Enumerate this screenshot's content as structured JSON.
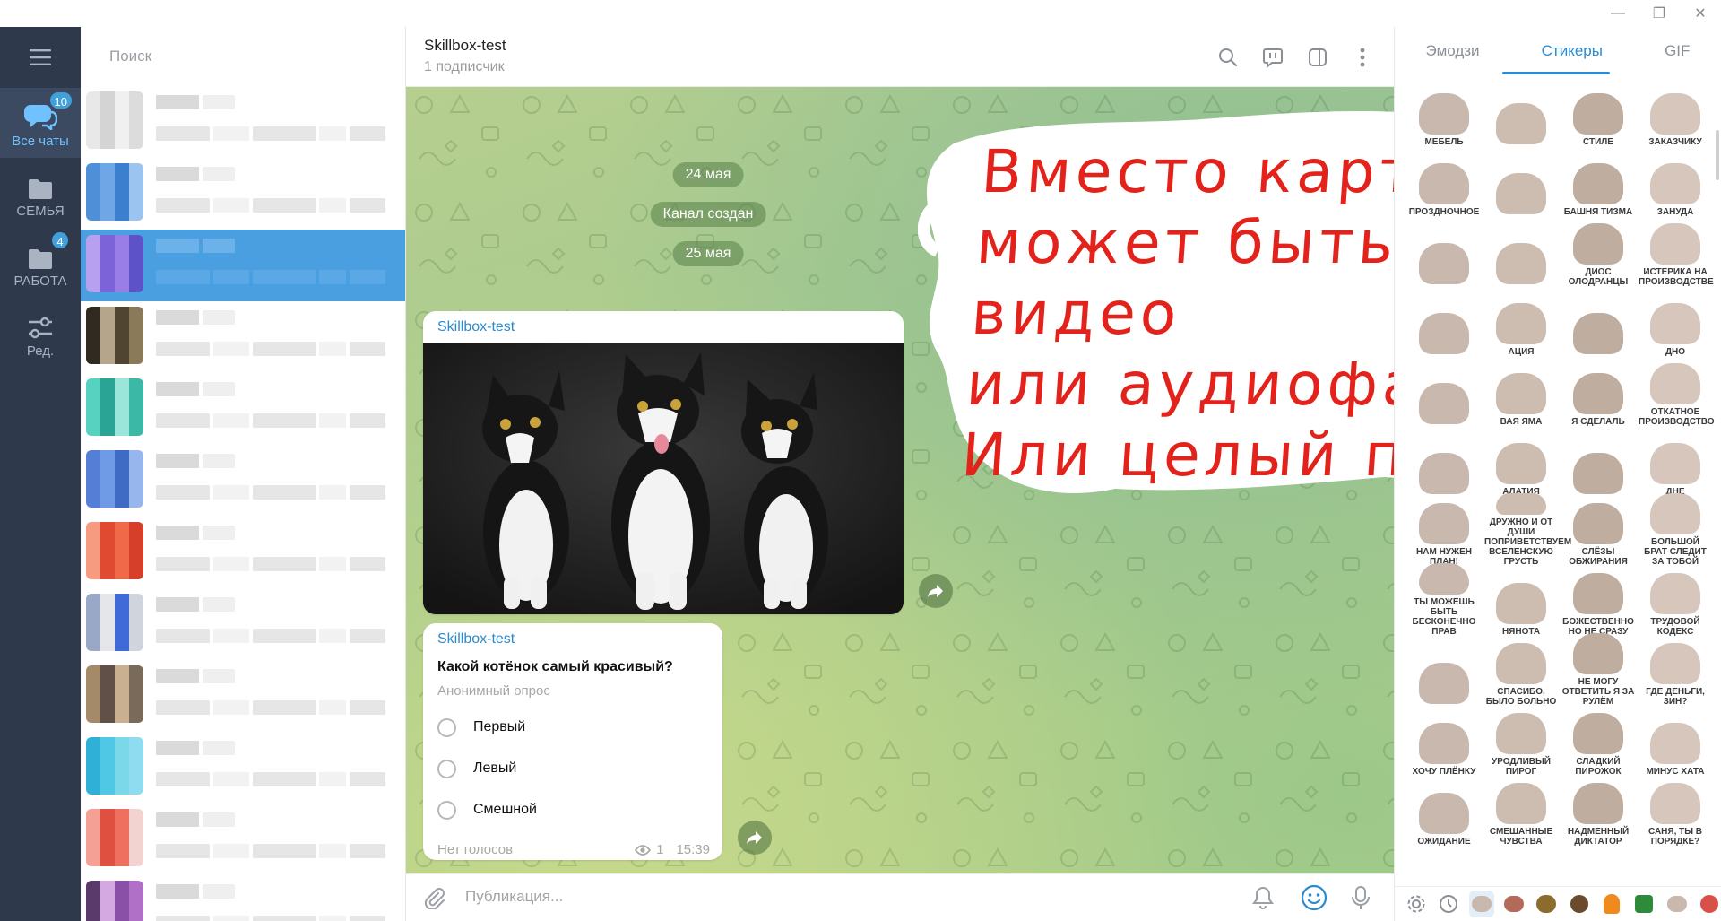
{
  "window": {
    "minimize": "—",
    "restore": "❐",
    "close": "✕"
  },
  "rail": {
    "folders": [
      {
        "label": "Все чаты",
        "badge": "10"
      },
      {
        "label": "СЕМЬЯ",
        "badge": ""
      },
      {
        "label": "РАБОТА",
        "badge": "4"
      },
      {
        "label": "Ред.",
        "badge": ""
      }
    ]
  },
  "chatlist": {
    "search_placeholder": "Поиск"
  },
  "chat": {
    "title": "Skillbox-test",
    "subtitle": "1 подписчик",
    "dates": [
      "24 мая",
      "Канал создан",
      "25 мая"
    ],
    "photo_post": {
      "author": "Skillbox-test"
    },
    "poll": {
      "author": "Skillbox-test",
      "question": "Какой котёнок самый красивый?",
      "type": "Анонимный опрос",
      "options": [
        "Первый",
        "Левый",
        "Смешной"
      ],
      "votes_label": "Нет голосов",
      "views": "1",
      "time": "15:39"
    },
    "composer_placeholder": "Публикация..."
  },
  "note": {
    "lines": [
      "Вместо картинки",
      "может быть видео",
      "или аудиофайл.",
      "Или целый пост."
    ],
    "color": "#e3231b"
  },
  "stickers": {
    "tabs": [
      "Эмодзи",
      "Стикеры",
      "GIF"
    ],
    "active_tab": "Стикеры",
    "labels": [
      "МЕБЕЛЬ",
      "",
      "СТИЛЕ",
      "ЗАКАЗЧИКУ",
      "ПРОЗДНОЧНОЕ",
      "",
      "БАШНЯ ТИЗМА",
      "ЗАНУДА",
      "",
      "",
      "ДИОС ОЛОДРАНЦЫ",
      "ИСТЕРИКА НА ПРОИЗВОДСТВЕ",
      "",
      "АЦИЯ",
      "",
      "ДНО",
      "",
      "ВАЯ ЯМА",
      "Я СДЕЛАЛЬ",
      "ОТКАТНОЕ ПРОИЗВОДСТВО",
      "",
      "АЛАТИЯ",
      "",
      "ДНЕ",
      "НАМ НУЖЕН ПЛАН!",
      "ДРУЖНО И ОТ ДУШИ ПОПРИВЕТСТВУЕМ ВСЕЛЕНСКУЮ ГРУСТЬ",
      "СЛЁЗЫ ОБЖИРАНИЯ",
      "БОЛЬШОЙ БРАТ СЛЕДИТ ЗА ТОБОЙ",
      "ТЫ МОЖЕШЬ БЫТЬ БЕСКОНЕЧНО ПРАВ",
      "НЯНОТА",
      "БОЖЕСТВЕННО НО НЕ СРАЗУ",
      "ТРУДОВОЙ КОДЕКС",
      "",
      "СПАСИБО, БЫЛО БОЛЬНО",
      "НЕ МОГУ ОТВЕТИТЬ Я ЗА РУЛЁМ",
      "ГДЕ ДЕНЬГИ, ЗИН?",
      "ХОЧУ ПЛЁНКУ",
      "УРОДЛИВЫЙ ПИРОГ",
      "СЛАДКИЙ ПИРОЖОК",
      "МИНУС ХАТА",
      "ОЖИДАНИЕ",
      "СМЕШАННЫЕ ЧУВСТВА",
      "НАДМЕННЫЙ ДИКТАТОР",
      "САНЯ, ТЫ В ПОРЯДКЕ?"
    ]
  },
  "colors": {
    "rail_bg": "#2e3a4b",
    "accent": "#419fd9",
    "selected_chat": "#4a9fe0"
  }
}
